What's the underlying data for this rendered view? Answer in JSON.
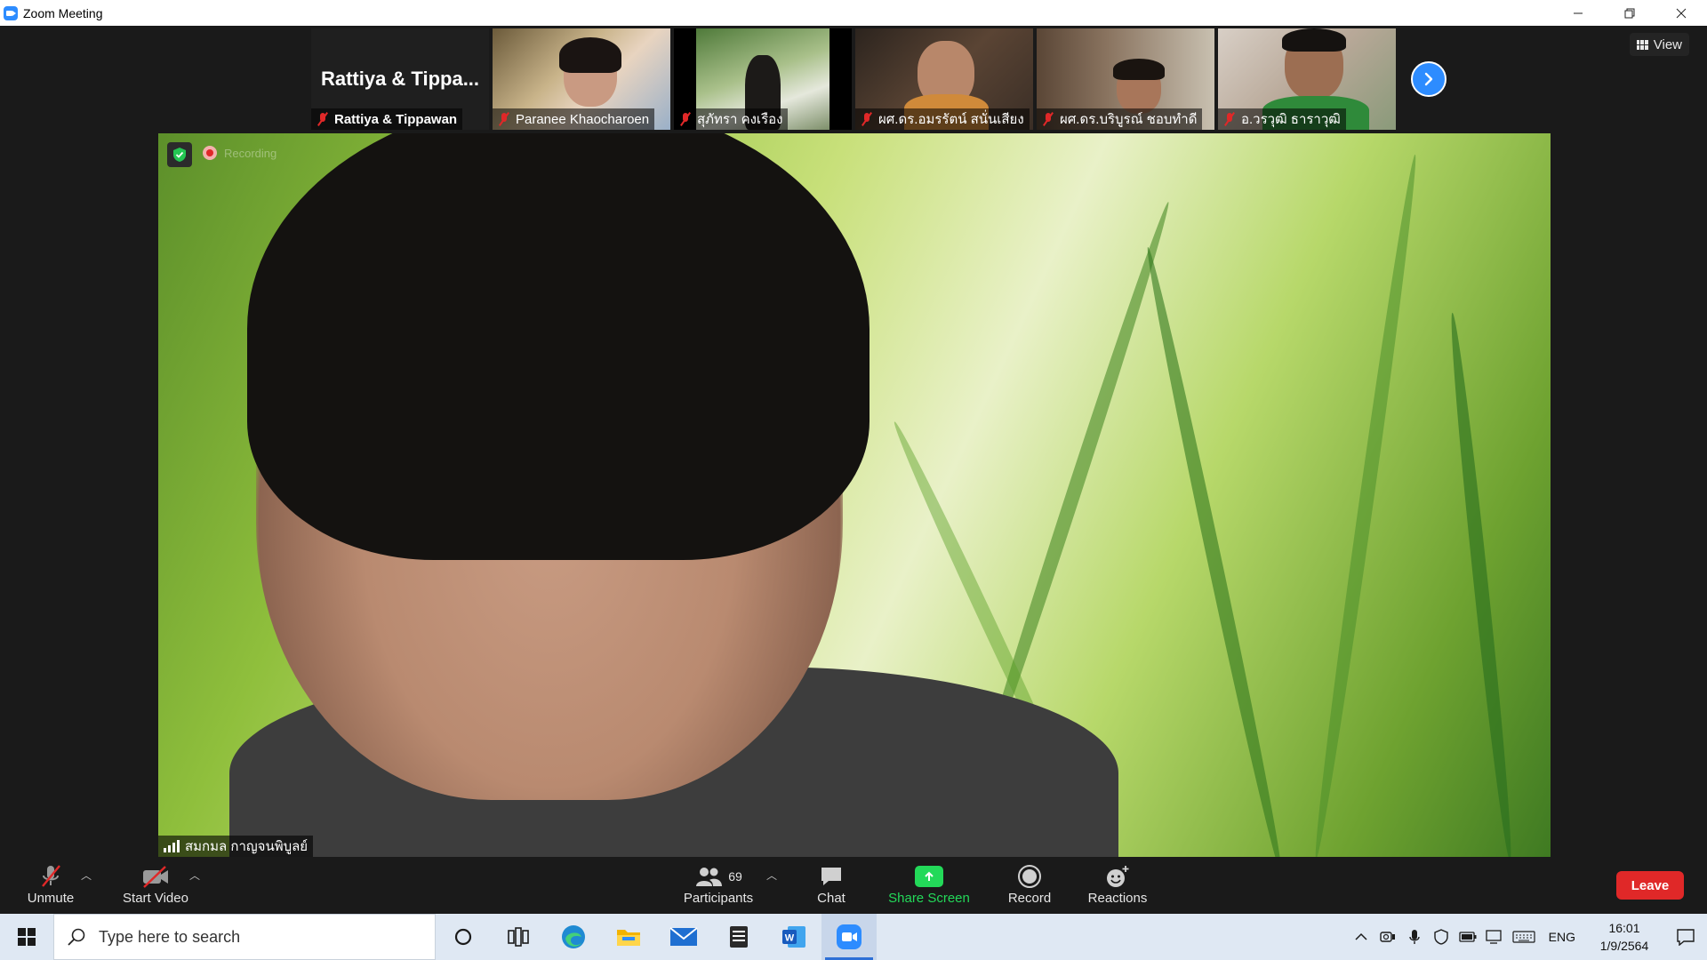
{
  "window": {
    "title": "Zoom Meeting"
  },
  "meeting": {
    "view_label": "View",
    "gallery": [
      {
        "name": "Rattiya & Tippawan",
        "display_title": "Rattiya & Tippa..."
      },
      {
        "name": "Paranee Khaocharoen"
      },
      {
        "name": "สุภัทรา คงเรือง"
      },
      {
        "name": "ผศ.ดร.อมรรัตน์ สนั่นเสียง"
      },
      {
        "name": "ผศ.ดร.บริบูรณ์ ชอบทำดี"
      },
      {
        "name": "อ.วรวุฒิ ธาราวุฒิ"
      }
    ],
    "recording_label": "Recording",
    "active_speaker": "สมกมล กาญจนพิบูลย์"
  },
  "toolbar": {
    "unmute_label": "Unmute",
    "start_video_label": "Start Video",
    "participants_label": "Participants",
    "participant_count": "69",
    "chat_label": "Chat",
    "share_screen_label": "Share Screen",
    "record_label": "Record",
    "reactions_label": "Reactions",
    "leave_label": "Leave"
  },
  "taskbar": {
    "search_placeholder": "Type here to search",
    "language": "ENG",
    "time": "16:01",
    "date": "1/9/2564"
  },
  "colors": {
    "zoom_blue": "#2d8cff",
    "share_green": "#23d959",
    "leave_red": "#e02828",
    "muted_red": "#e02828"
  }
}
